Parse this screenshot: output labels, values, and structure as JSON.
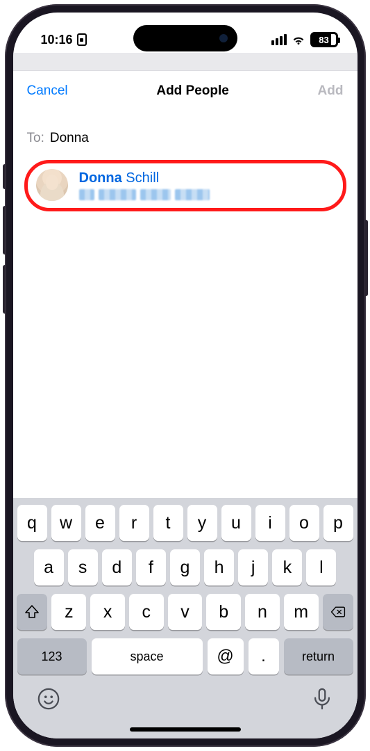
{
  "status": {
    "time": "10:16",
    "battery": "83"
  },
  "nav": {
    "cancel": "Cancel",
    "title": "Add People",
    "add": "Add"
  },
  "to_field": {
    "label": "To:",
    "value": "Donna"
  },
  "suggestion": {
    "first_name": "Donna",
    "last_name": "Schill"
  },
  "keyboard": {
    "row1": [
      "q",
      "w",
      "e",
      "r",
      "t",
      "y",
      "u",
      "i",
      "o",
      "p"
    ],
    "row2": [
      "a",
      "s",
      "d",
      "f",
      "g",
      "h",
      "j",
      "k",
      "l"
    ],
    "row3": [
      "z",
      "x",
      "c",
      "v",
      "b",
      "n",
      "m"
    ],
    "numbers": "123",
    "space": "space",
    "at": "@",
    "dot": ".",
    "return": "return"
  }
}
